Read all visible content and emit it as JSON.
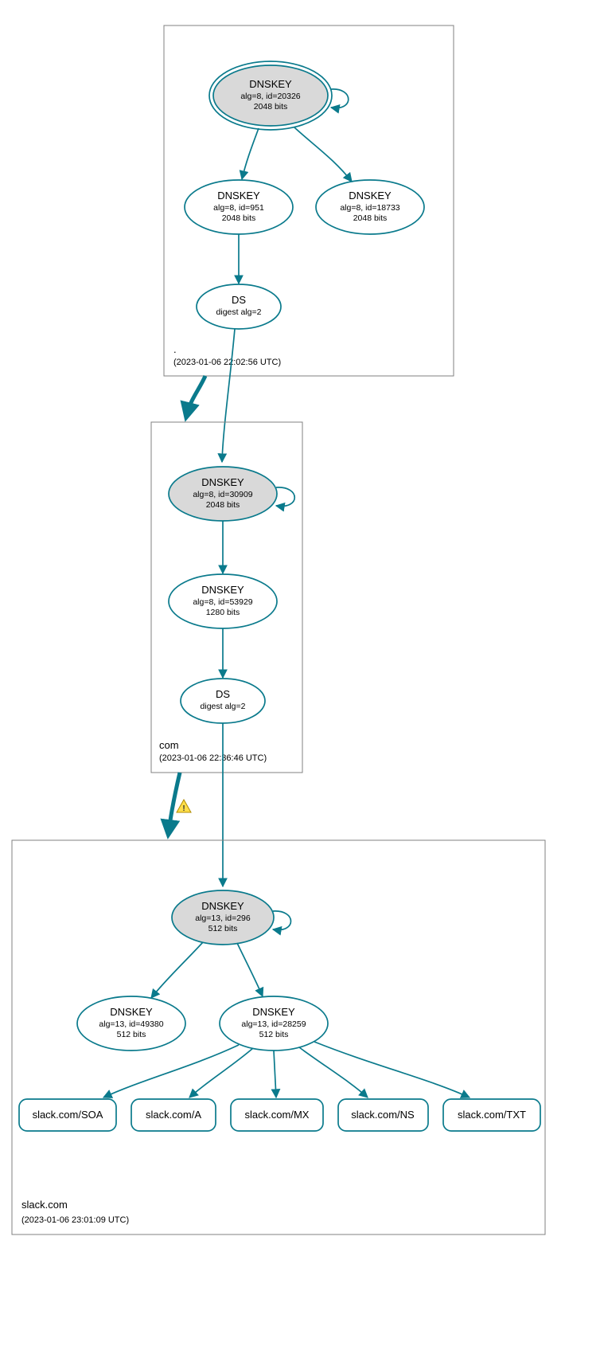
{
  "chart_data": {
    "type": "tree",
    "zones": [
      {
        "name": ".",
        "timestamp": "(2023-01-06 22:02:56 UTC)",
        "nodes": [
          {
            "id": "root_ksk",
            "type": "DNSKEY",
            "line2": "alg=8, id=20326",
            "line3": "2048 bits",
            "trust_anchor": true
          },
          {
            "id": "root_zsk1",
            "type": "DNSKEY",
            "line2": "alg=8, id=951",
            "line3": "2048 bits",
            "trust_anchor": false
          },
          {
            "id": "root_zsk2",
            "type": "DNSKEY",
            "line2": "alg=8, id=18733",
            "line3": "2048 bits",
            "trust_anchor": false
          },
          {
            "id": "root_ds",
            "type": "DS",
            "line2": "digest alg=2",
            "line3": "",
            "trust_anchor": false
          }
        ]
      },
      {
        "name": "com",
        "timestamp": "(2023-01-06 22:36:46 UTC)",
        "nodes": [
          {
            "id": "com_ksk",
            "type": "DNSKEY",
            "line2": "alg=8, id=30909",
            "line3": "2048 bits",
            "trust_anchor": true
          },
          {
            "id": "com_zsk",
            "type": "DNSKEY",
            "line2": "alg=8, id=53929",
            "line3": "1280 bits",
            "trust_anchor": false
          },
          {
            "id": "com_ds",
            "type": "DS",
            "line2": "digest alg=2",
            "line3": "",
            "trust_anchor": false
          }
        ]
      },
      {
        "name": "slack.com",
        "timestamp": "(2023-01-06 23:01:09 UTC)",
        "nodes": [
          {
            "id": "slack_ksk",
            "type": "DNSKEY",
            "line2": "alg=13, id=296",
            "line3": "512 bits",
            "trust_anchor": true
          },
          {
            "id": "slack_zsk1",
            "type": "DNSKEY",
            "line2": "alg=13, id=49380",
            "line3": "512 bits",
            "trust_anchor": false
          },
          {
            "id": "slack_zsk2",
            "type": "DNSKEY",
            "line2": "alg=13, id=28259",
            "line3": "512 bits",
            "trust_anchor": false
          }
        ],
        "rrsets": [
          {
            "label": "slack.com/SOA"
          },
          {
            "label": "slack.com/A"
          },
          {
            "label": "slack.com/MX"
          },
          {
            "label": "slack.com/NS"
          },
          {
            "label": "slack.com/TXT"
          }
        ]
      }
    ],
    "edges": [
      {
        "from": "root_ksk",
        "to": "root_ksk",
        "self": true
      },
      {
        "from": "root_ksk",
        "to": "root_zsk1"
      },
      {
        "from": "root_ksk",
        "to": "root_zsk2"
      },
      {
        "from": "root_zsk1",
        "to": "root_ds"
      },
      {
        "from": "root_ds",
        "to": "com_ksk",
        "delegation": true
      },
      {
        "from": "com_ksk",
        "to": "com_ksk",
        "self": true
      },
      {
        "from": "com_ksk",
        "to": "com_zsk"
      },
      {
        "from": "com_zsk",
        "to": "com_ds"
      },
      {
        "from": "com_ds",
        "to": "slack_ksk",
        "delegation": true,
        "warning": true
      },
      {
        "from": "slack_ksk",
        "to": "slack_ksk",
        "self": true
      },
      {
        "from": "slack_ksk",
        "to": "slack_zsk1"
      },
      {
        "from": "slack_ksk",
        "to": "slack_zsk2"
      },
      {
        "from": "slack_zsk2",
        "to": "slack.com/SOA"
      },
      {
        "from": "slack_zsk2",
        "to": "slack.com/A"
      },
      {
        "from": "slack_zsk2",
        "to": "slack.com/MX"
      },
      {
        "from": "slack_zsk2",
        "to": "slack.com/NS"
      },
      {
        "from": "slack_zsk2",
        "to": "slack.com/TXT"
      }
    ]
  }
}
